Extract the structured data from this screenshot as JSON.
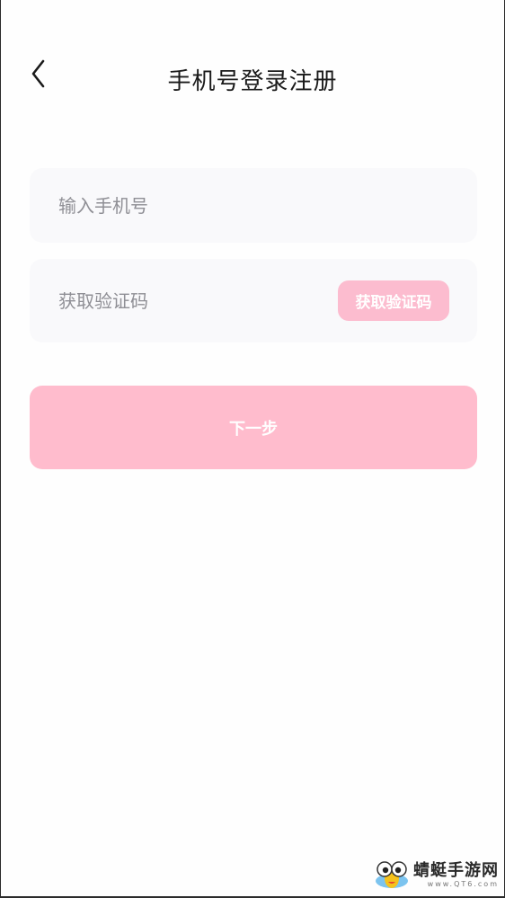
{
  "header": {
    "title": "手机号登录注册",
    "back_icon": "chevron-left-icon"
  },
  "form": {
    "phone_placeholder": "输入手机号",
    "phone_value": "",
    "code_placeholder": "获取验证码",
    "code_value": "",
    "get_code_label": "获取验证码"
  },
  "actions": {
    "next_label": "下一步"
  },
  "watermark": {
    "name": "蜻蜓手游网",
    "site": "www.QT6.com"
  },
  "colors": {
    "accent": "#ffbccd",
    "field_bg": "#f9f9fb",
    "title_text": "#1a1a1a",
    "placeholder_text": "#8f8f95"
  }
}
